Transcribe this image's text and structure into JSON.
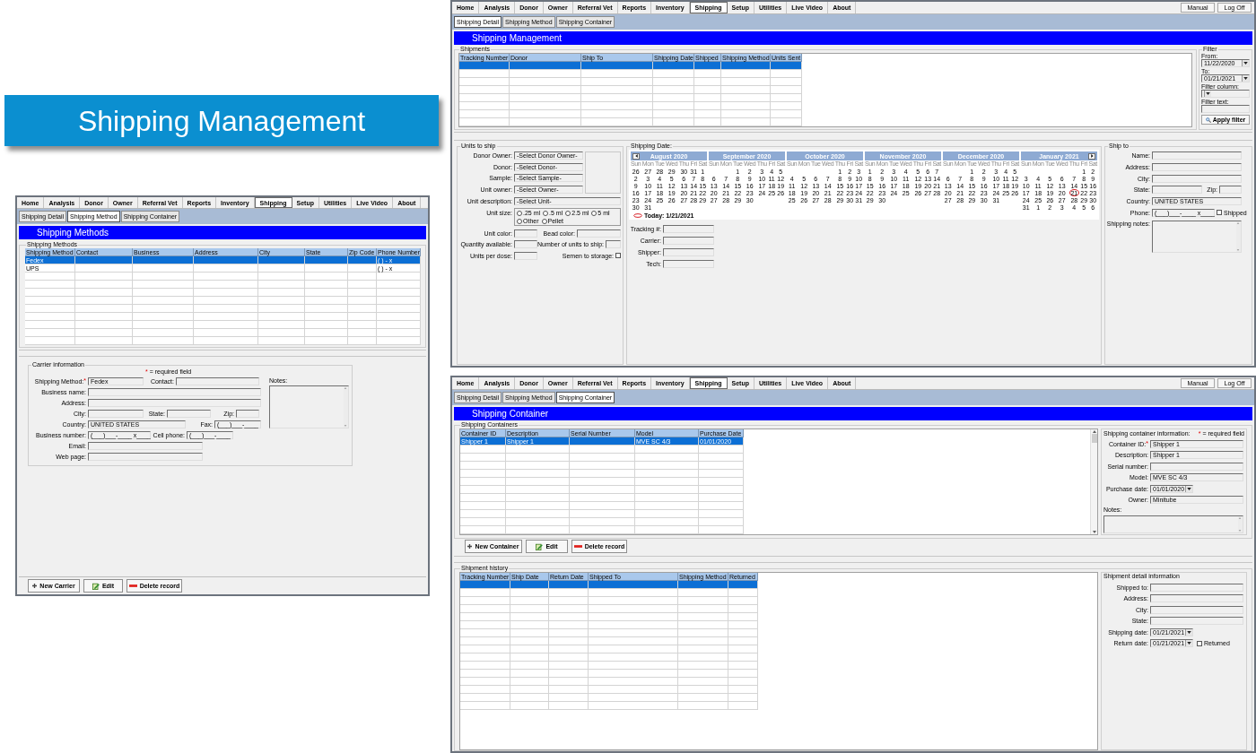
{
  "banner": {
    "title": "Shipping Management"
  },
  "methods_window": {
    "menu": [
      {
        "label": "Home",
        "selected": false
      },
      {
        "label": "Analysis",
        "selected": false
      },
      {
        "label": "Donor",
        "selected": false
      },
      {
        "label": "Owner",
        "selected": false
      },
      {
        "label": "Referral Vet",
        "selected": false
      },
      {
        "label": "Reports",
        "selected": false
      },
      {
        "label": "Inventory",
        "selected": false
      },
      {
        "label": "Shipping",
        "selected": true
      },
      {
        "label": "Setup",
        "selected": false
      },
      {
        "label": "Utilities",
        "selected": false
      },
      {
        "label": "Live Video",
        "selected": false
      },
      {
        "label": "About",
        "selected": false
      }
    ],
    "subtabs": [
      {
        "label": "Shipping Detail",
        "selected": false
      },
      {
        "label": "Shipping Method",
        "selected": true
      },
      {
        "label": "Shipping Container",
        "selected": false
      }
    ],
    "title": "Shipping Methods",
    "methods_group": {
      "label": "Shipping Methods",
      "columns": [
        "Shipping Method",
        "Contact",
        "Business",
        "Address",
        "City",
        "State",
        "Zip Code",
        "Phone Number"
      ],
      "rows": [
        {
          "cells": [
            "Fedex",
            null,
            null,
            null,
            null,
            null,
            null,
            "( ) - x"
          ],
          "selected": true
        },
        {
          "cells": [
            "UPS",
            null,
            null,
            null,
            null,
            null,
            null,
            "( ) - x"
          ],
          "selected": false
        }
      ]
    },
    "carrier_group": {
      "label": "Carrier information",
      "required_mark": "*",
      "required_text": "= required field",
      "fields": [
        {
          "label": "Shipping Method:",
          "mark": "*",
          "value": "Fedex"
        },
        {
          "label": "Contact:"
        },
        {
          "label": "Business name:"
        },
        {
          "label": "Address:"
        },
        {
          "label": "City:"
        },
        {
          "label": "State:"
        },
        {
          "label": "Zip:"
        },
        {
          "label": "Country:",
          "value": "UNITED STATES"
        },
        {
          "label": "Fax:",
          "value": "(___)___-____"
        },
        {
          "label": "Business number:",
          "value": "(___)___-____ x____"
        },
        {
          "label": "Cell phone:",
          "value": "(___)___-____"
        },
        {
          "label": "Email:"
        },
        {
          "label": "Web page:"
        }
      ],
      "notes": {
        "label": "Notes:"
      }
    },
    "buttons": [
      {
        "kind": "new",
        "label": "New Carrier"
      },
      {
        "kind": "edit",
        "label": "Edit"
      },
      {
        "kind": "delete",
        "label": "Delete record"
      }
    ]
  },
  "management_window": {
    "menu": [
      {
        "label": "Home",
        "selected": false
      },
      {
        "label": "Analysis",
        "selected": false
      },
      {
        "label": "Donor",
        "selected": false
      },
      {
        "label": "Owner",
        "selected": false
      },
      {
        "label": "Referral Vet",
        "selected": false
      },
      {
        "label": "Reports",
        "selected": false
      },
      {
        "label": "Inventory",
        "selected": false
      },
      {
        "label": "Shipping",
        "selected": true
      },
      {
        "label": "Setup",
        "selected": false
      },
      {
        "label": "Utilities",
        "selected": false
      },
      {
        "label": "Live Video",
        "selected": false
      },
      {
        "label": "About",
        "selected": false
      }
    ],
    "right_buttons": [
      {
        "label": "Manual"
      },
      {
        "label": "Log Off"
      }
    ],
    "subtabs": [
      {
        "label": "Shipping Detail",
        "selected": true
      },
      {
        "label": "Shipping Method",
        "selected": false
      },
      {
        "label": "Shipping Container",
        "selected": false
      }
    ],
    "title": "Shipping Management",
    "shipments_group": {
      "label": "Shipments",
      "columns": [
        "Tracking Number",
        "Donor",
        "Ship To",
        "Shipping Date",
        "Shipped",
        "Shipping Method",
        "Units Sent"
      ],
      "rows": [
        {
          "selected": true
        }
      ]
    },
    "filter": {
      "label": "Filter",
      "fields": [
        {
          "kind": "date",
          "label": "From:",
          "value": "11/22/2020"
        },
        {
          "kind": "date",
          "label": "To:",
          "value": "01/21/2021"
        },
        {
          "kind": "dropdown",
          "label": "Filter column:"
        },
        {
          "kind": "text",
          "label": "Filter text:"
        }
      ],
      "apply_button": "Apply filter"
    },
    "units_group": {
      "label": "Units to ship",
      "selects": [
        {
          "label": "Donor Owner:",
          "value": "-Select Donor Owner-"
        },
        {
          "label": "Donor:",
          "value": "-Select Donor-"
        },
        {
          "label": "Sample:",
          "value": "-Select Sample-"
        },
        {
          "label": "Unit owner:",
          "value": "-Select Owner-"
        },
        {
          "label": "Unit description:",
          "value": "-Select Unit-"
        }
      ],
      "unit_size": {
        "label": "Unit size:",
        "options": [
          {
            "label": ".25 ml",
            "selected": false
          },
          {
            "label": ".5 ml",
            "selected": false
          },
          {
            "label": "2.5 ml",
            "selected": false
          },
          {
            "label": "5 ml",
            "selected": false
          },
          {
            "label": "Other",
            "selected": false
          },
          {
            "label": "Pellet",
            "selected": false
          }
        ]
      },
      "fields": [
        {
          "label": "Unit color:"
        },
        {
          "label": "Bead color:"
        },
        {
          "label": "Quantity available:"
        },
        {
          "label": "Number of units to ship:"
        },
        {
          "label": "Units per dose:"
        }
      ],
      "semen_to_storage": {
        "label": "Semen to storage:",
        "checked": false
      }
    },
    "date_group": {
      "label": "Shipping Date:",
      "calendar": {
        "months": [
          {
            "title": "August 2020",
            "weekdays": [
              "Sun",
              "Mon",
              "Tue",
              "Wed",
              "Thu",
              "Fri",
              "Sat"
            ],
            "weeks": [
              [
                {
                  "day": "26",
                  "selected": false
                },
                {
                  "day": "27",
                  "selected": false
                },
                {
                  "day": "28",
                  "selected": false
                },
                {
                  "day": "29",
                  "selected": false
                },
                {
                  "day": "30",
                  "selected": false
                },
                {
                  "day": "31",
                  "selected": false
                },
                {
                  "day": "1",
                  "selected": false
                }
              ],
              [
                {
                  "day": "2",
                  "selected": false
                },
                {
                  "day": "3",
                  "selected": false
                },
                {
                  "day": "4",
                  "selected": false
                },
                {
                  "day": "5",
                  "selected": false
                },
                {
                  "day": "6",
                  "selected": false
                },
                {
                  "day": "7",
                  "selected": false
                },
                {
                  "day": "8",
                  "selected": false
                }
              ],
              [
                {
                  "day": "9",
                  "selected": false
                },
                {
                  "day": "10",
                  "selected": false
                },
                {
                  "day": "11",
                  "selected": false
                },
                {
                  "day": "12",
                  "selected": false
                },
                {
                  "day": "13",
                  "selected": false
                },
                {
                  "day": "14",
                  "selected": false
                },
                {
                  "day": "15",
                  "selected": false
                }
              ],
              [
                {
                  "day": "16",
                  "selected": false
                },
                {
                  "day": "17",
                  "selected": false
                },
                {
                  "day": "18",
                  "selected": false
                },
                {
                  "day": "19",
                  "selected": false
                },
                {
                  "day": "20",
                  "selected": false
                },
                {
                  "day": "21",
                  "selected": false
                },
                {
                  "day": "22",
                  "selected": false
                }
              ],
              [
                {
                  "day": "23",
                  "selected": false
                },
                {
                  "day": "24",
                  "selected": false
                },
                {
                  "day": "25",
                  "selected": false
                },
                {
                  "day": "26",
                  "selected": false
                },
                {
                  "day": "27",
                  "selected": false
                },
                {
                  "day": "28",
                  "selected": false
                },
                {
                  "day": "29",
                  "selected": false
                }
              ],
              [
                {
                  "day": "30",
                  "selected": false
                },
                {
                  "day": "31",
                  "selected": false
                }
              ]
            ]
          },
          {
            "title": "September 2020",
            "weekdays": [
              "Sun",
              "Mon",
              "Tue",
              "Wed",
              "Thu",
              "Fri",
              "Sat"
            ],
            "weeks": [
              [
                {
                  "day": "1",
                  "selected": false
                },
                {
                  "day": "2",
                  "selected": false
                },
                {
                  "day": "3",
                  "selected": false
                },
                {
                  "day": "4",
                  "selected": false
                },
                {
                  "day": "5",
                  "selected": false
                }
              ],
              [
                {
                  "day": "6",
                  "selected": false
                },
                {
                  "day": "7",
                  "selected": false
                },
                {
                  "day": "8",
                  "selected": false
                },
                {
                  "day": "9",
                  "selected": false
                },
                {
                  "day": "10",
                  "selected": false
                },
                {
                  "day": "11",
                  "selected": false
                },
                {
                  "day": "12",
                  "selected": false
                }
              ],
              [
                {
                  "day": "13",
                  "selected": false
                },
                {
                  "day": "14",
                  "selected": false
                },
                {
                  "day": "15",
                  "selected": false
                },
                {
                  "day": "16",
                  "selected": false
                },
                {
                  "day": "17",
                  "selected": false
                },
                {
                  "day": "18",
                  "selected": false
                },
                {
                  "day": "19",
                  "selected": false
                }
              ],
              [
                {
                  "day": "20",
                  "selected": false
                },
                {
                  "day": "21",
                  "selected": false
                },
                {
                  "day": "22",
                  "selected": false
                },
                {
                  "day": "23",
                  "selected": false
                },
                {
                  "day": "24",
                  "selected": false
                },
                {
                  "day": "25",
                  "selected": false
                },
                {
                  "day": "26",
                  "selected": false
                }
              ],
              [
                {
                  "day": "27",
                  "selected": false
                },
                {
                  "day": "28",
                  "selected": false
                },
                {
                  "day": "29",
                  "selected": false
                },
                {
                  "day": "30",
                  "selected": false
                }
              ]
            ]
          },
          {
            "title": "October 2020",
            "weekdays": [
              "Sun",
              "Mon",
              "Tue",
              "Wed",
              "Thu",
              "Fri",
              "Sat"
            ],
            "weeks": [
              [
                {
                  "day": "1",
                  "selected": false
                },
                {
                  "day": "2",
                  "selected": false
                },
                {
                  "day": "3",
                  "selected": false
                }
              ],
              [
                {
                  "day": "4",
                  "selected": false
                },
                {
                  "day": "5",
                  "selected": false
                },
                {
                  "day": "6",
                  "selected": false
                },
                {
                  "day": "7",
                  "selected": false
                },
                {
                  "day": "8",
                  "selected": false
                },
                {
                  "day": "9",
                  "selected": false
                },
                {
                  "day": "10",
                  "selected": false
                }
              ],
              [
                {
                  "day": "11",
                  "selected": false
                },
                {
                  "day": "12",
                  "selected": false
                },
                {
                  "day": "13",
                  "selected": false
                },
                {
                  "day": "14",
                  "selected": false
                },
                {
                  "day": "15",
                  "selected": false
                },
                {
                  "day": "16",
                  "selected": false
                },
                {
                  "day": "17",
                  "selected": false
                }
              ],
              [
                {
                  "day": "18",
                  "selected": false
                },
                {
                  "day": "19",
                  "selected": false
                },
                {
                  "day": "20",
                  "selected": false
                },
                {
                  "day": "21",
                  "selected": false
                },
                {
                  "day": "22",
                  "selected": false
                },
                {
                  "day": "23",
                  "selected": false
                },
                {
                  "day": "24",
                  "selected": false
                }
              ],
              [
                {
                  "day": "25",
                  "selected": false
                },
                {
                  "day": "26",
                  "selected": false
                },
                {
                  "day": "27",
                  "selected": false
                },
                {
                  "day": "28",
                  "selected": false
                },
                {
                  "day": "29",
                  "selected": false
                },
                {
                  "day": "30",
                  "selected": false
                },
                {
                  "day": "31",
                  "selected": false
                }
              ]
            ]
          },
          {
            "title": "November 2020",
            "weekdays": [
              "Sun",
              "Mon",
              "Tue",
              "Wed",
              "Thu",
              "Fri",
              "Sat"
            ],
            "weeks": [
              [
                {
                  "day": "1",
                  "selected": false
                },
                {
                  "day": "2",
                  "selected": false
                },
                {
                  "day": "3",
                  "selected": false
                },
                {
                  "day": "4",
                  "selected": false
                },
                {
                  "day": "5",
                  "selected": false
                },
                {
                  "day": "6",
                  "selected": false
                },
                {
                  "day": "7",
                  "selected": false
                }
              ],
              [
                {
                  "day": "8",
                  "selected": false
                },
                {
                  "day": "9",
                  "selected": false
                },
                {
                  "day": "10",
                  "selected": false
                },
                {
                  "day": "11",
                  "selected": false
                },
                {
                  "day": "12",
                  "selected": false
                },
                {
                  "day": "13",
                  "selected": false
                },
                {
                  "day": "14",
                  "selected": false
                }
              ],
              [
                {
                  "day": "15",
                  "selected": false
                },
                {
                  "day": "16",
                  "selected": false
                },
                {
                  "day": "17",
                  "selected": false
                },
                {
                  "day": "18",
                  "selected": false
                },
                {
                  "day": "19",
                  "selected": false
                },
                {
                  "day": "20",
                  "selected": false
                },
                {
                  "day": "21",
                  "selected": false
                }
              ],
              [
                {
                  "day": "22",
                  "selected": false
                },
                {
                  "day": "23",
                  "selected": false
                },
                {
                  "day": "24",
                  "selected": false
                },
                {
                  "day": "25",
                  "selected": false
                },
                {
                  "day": "26",
                  "selected": false
                },
                {
                  "day": "27",
                  "selected": false
                },
                {
                  "day": "28",
                  "selected": false
                }
              ],
              [
                {
                  "day": "29",
                  "selected": false
                },
                {
                  "day": "30",
                  "selected": false
                }
              ]
            ]
          },
          {
            "title": "December 2020",
            "weekdays": [
              "Sun",
              "Mon",
              "Tue",
              "Wed",
              "Thu",
              "Fri",
              "Sat"
            ],
            "weeks": [
              [
                {
                  "day": "1",
                  "selected": false
                },
                {
                  "day": "2",
                  "selected": false
                },
                {
                  "day": "3",
                  "selected": false
                },
                {
                  "day": "4",
                  "selected": false
                },
                {
                  "day": "5",
                  "selected": false
                }
              ],
              [
                {
                  "day": "6",
                  "selected": false
                },
                {
                  "day": "7",
                  "selected": false
                },
                {
                  "day": "8",
                  "selected": false
                },
                {
                  "day": "9",
                  "selected": false
                },
                {
                  "day": "10",
                  "selected": false
                },
                {
                  "day": "11",
                  "selected": false
                },
                {
                  "day": "12",
                  "selected": false
                }
              ],
              [
                {
                  "day": "13",
                  "selected": false
                },
                {
                  "day": "14",
                  "selected": false
                },
                {
                  "day": "15",
                  "selected": false
                },
                {
                  "day": "16",
                  "selected": false
                },
                {
                  "day": "17",
                  "selected": false
                },
                {
                  "day": "18",
                  "selected": false
                },
                {
                  "day": "19",
                  "selected": false
                }
              ],
              [
                {
                  "day": "20",
                  "selected": false
                },
                {
                  "day": "21",
                  "selected": false
                },
                {
                  "day": "22",
                  "selected": false
                },
                {
                  "day": "23",
                  "selected": false
                },
                {
                  "day": "24",
                  "selected": false
                },
                {
                  "day": "25",
                  "selected": false
                },
                {
                  "day": "26",
                  "selected": false
                }
              ],
              [
                {
                  "day": "27",
                  "selected": false
                },
                {
                  "day": "28",
                  "selected": false
                },
                {
                  "day": "29",
                  "selected": false
                },
                {
                  "day": "30",
                  "selected": false
                },
                {
                  "day": "31",
                  "selected": false
                }
              ]
            ]
          },
          {
            "title": "January 2021",
            "weekdays": [
              "Sun",
              "Mon",
              "Tue",
              "Wed",
              "Thu",
              "Fri",
              "Sat"
            ],
            "weeks": [
              [
                {
                  "day": "1",
                  "selected": false
                },
                {
                  "day": "2",
                  "selected": false
                }
              ],
              [
                {
                  "day": "3",
                  "selected": false
                },
                {
                  "day": "4",
                  "selected": false
                },
                {
                  "day": "5",
                  "selected": false
                },
                {
                  "day": "6",
                  "selected": false
                },
                {
                  "day": "7",
                  "selected": false
                },
                {
                  "day": "8",
                  "selected": false
                },
                {
                  "day": "9",
                  "selected": false
                }
              ],
              [
                {
                  "day": "10",
                  "selected": false
                },
                {
                  "day": "11",
                  "selected": false
                },
                {
                  "day": "12",
                  "selected": false
                },
                {
                  "day": "13",
                  "selected": false
                },
                {
                  "day": "14",
                  "selected": false
                },
                {
                  "day": "15",
                  "selected": false
                },
                {
                  "day": "16",
                  "selected": false
                }
              ],
              [
                {
                  "day": "17",
                  "selected": false
                },
                {
                  "day": "18",
                  "selected": false
                },
                {
                  "day": "19",
                  "selected": false
                },
                {
                  "day": "20",
                  "selected": false
                },
                {
                  "day": "21",
                  "selected": true
                },
                {
                  "day": "22",
                  "selected": false
                },
                {
                  "day": "23",
                  "selected": false
                }
              ],
              [
                {
                  "day": "24",
                  "selected": false
                },
                {
                  "day": "25",
                  "selected": false
                },
                {
                  "day": "26",
                  "selected": false
                },
                {
                  "day": "27",
                  "selected": false
                },
                {
                  "day": "28",
                  "selected": false
                },
                {
                  "day": "29",
                  "selected": false
                },
                {
                  "day": "30",
                  "selected": false
                }
              ],
              [
                {
                  "day": "31",
                  "selected": false
                },
                {
                  "day": "1",
                  "selected": false
                },
                {
                  "day": "2",
                  "selected": false
                },
                {
                  "day": "3",
                  "selected": false
                },
                {
                  "day": "4",
                  "selected": false
                },
                {
                  "day": "5",
                  "selected": false
                },
                {
                  "day": "6",
                  "selected": false
                }
              ]
            ]
          }
        ],
        "today_label": "Today: 1/21/2021"
      },
      "fields": [
        {
          "label": "Tracking #:"
        },
        {
          "label": "Carrier:"
        },
        {
          "label": "Shipper:"
        },
        {
          "label": "Tech:"
        }
      ]
    },
    "ship_to_group": {
      "label": "Ship to",
      "fields": [
        {
          "label": "Name:"
        },
        {
          "label": "Address:"
        },
        {
          "label": "City:"
        },
        {
          "label": "State:"
        },
        {
          "label": "Zip:"
        },
        {
          "label": "Country:",
          "value": "UNITED STATES"
        },
        {
          "label": "Phone:",
          "value": "(___)___-____ x____"
        }
      ],
      "shipped": {
        "label": "Shipped",
        "checked": false
      },
      "notes": {
        "label": "Shipping notes:"
      }
    }
  },
  "container_window": {
    "menu": [
      {
        "label": "Home",
        "selected": false
      },
      {
        "label": "Analysis",
        "selected": false
      },
      {
        "label": "Donor",
        "selected": false
      },
      {
        "label": "Owner",
        "selected": false
      },
      {
        "label": "Referral Vet",
        "selected": false
      },
      {
        "label": "Reports",
        "selected": false
      },
      {
        "label": "Inventory",
        "selected": false
      },
      {
        "label": "Shipping",
        "selected": true
      },
      {
        "label": "Setup",
        "selected": false
      },
      {
        "label": "Utilities",
        "selected": false
      },
      {
        "label": "Live Video",
        "selected": false
      },
      {
        "label": "About",
        "selected": false
      }
    ],
    "right_buttons": [
      {
        "label": "Manual"
      },
      {
        "label": "Log Off"
      }
    ],
    "subtabs": [
      {
        "label": "Shipping Detail",
        "selected": false
      },
      {
        "label": "Shipping Method",
        "selected": false
      },
      {
        "label": "Shipping Container",
        "selected": true
      }
    ],
    "title": "Shipping Container",
    "containers_group": {
      "label": "Shipping Containers",
      "columns": [
        "Container ID",
        "Description",
        "Serial Number",
        "Model",
        "Purchase Date"
      ],
      "rows": [
        {
          "cells": [
            "Shipper 1",
            "Shipper 1",
            null,
            "MVE SC 4/3",
            "01/01/2020"
          ],
          "selected": true
        }
      ]
    },
    "info_panel": {
      "label": "Shipping container information:",
      "required_mark": "*",
      "required_text": "= required field",
      "fields": [
        {
          "kind": "text",
          "label": "Container ID:",
          "mark": "*",
          "value": "Shipper 1"
        },
        {
          "kind": "text",
          "label": "Description:",
          "value": "Shipper 1"
        },
        {
          "kind": "text",
          "label": "Serial number:"
        },
        {
          "kind": "text",
          "label": "Model:",
          "value": "MVE SC 4/3"
        },
        {
          "kind": "date",
          "label": "Purchase date:",
          "value": "01/01/2020"
        },
        {
          "kind": "text",
          "label": "Owner:",
          "value": "Minitube"
        }
      ],
      "notes": {
        "label": "Notes:"
      }
    },
    "buttons": [
      {
        "kind": "new",
        "label": "New Container"
      },
      {
        "kind": "edit",
        "label": "Edit"
      },
      {
        "kind": "delete",
        "label": "Delete record"
      }
    ],
    "history_group": {
      "label": "Shipment history",
      "columns": [
        "Tracking Number",
        "Ship Date",
        "Return Date",
        "Shipped To",
        "Shipping Method",
        "Returned"
      ],
      "rows": [
        {
          "selected": true
        }
      ]
    },
    "detail_panel": {
      "label": "Shipment detail information",
      "fields": [
        {
          "kind": "text",
          "label": "Shipped to:"
        },
        {
          "kind": "text",
          "label": "Address:"
        },
        {
          "kind": "text",
          "label": "City:"
        },
        {
          "kind": "text",
          "label": "State:"
        },
        {
          "kind": "date",
          "label": "Shipping date:",
          "value": "01/21/2021"
        },
        {
          "kind": "date",
          "label": "Return date:",
          "value": "01/21/2021"
        }
      ],
      "returned": {
        "label": "Returned",
        "checked": false
      }
    }
  }
}
